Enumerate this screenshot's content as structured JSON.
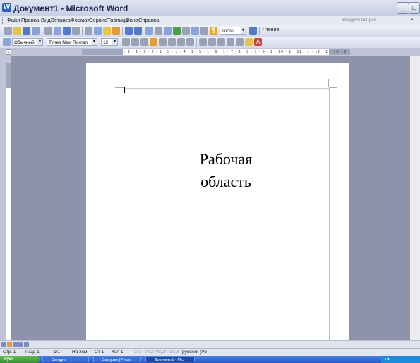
{
  "window": {
    "title": "Документ1 - Microsoft Word",
    "app_icon": "W"
  },
  "menubar": {
    "items": [
      "Файл",
      "Правка",
      "Вид",
      "Вставка",
      "Формат",
      "Сервис",
      "Таблица",
      "Окно",
      "Справка"
    ],
    "help_placeholder": "Введите вопрос"
  },
  "toolbar_standard": {
    "zoom": "100%",
    "reading_label": "Чтение"
  },
  "toolbar_formatting": {
    "style": "Обычный",
    "font": "Times New Roman",
    "size": "12",
    "letter": "A"
  },
  "ruler": {
    "ticks": "· 1 · 1 · 1 · 2 · 1 · 3 · 1 · 4 · 1 · 5 · 1 · 6 · 1 · 7 · 1 · 8 · 1 · 9 · 1 · 10 · 1 · 11 · 1 · 12 · 1 · 13 · 1 · 14 · 1 · 15 · 1 · 16 · 1 · 17 ·"
  },
  "document": {
    "label_line1": "Рабочая",
    "label_line2": "область"
  },
  "statusbar": {
    "page": "Стр. 1",
    "section": "Разд 1",
    "pages": "1/1",
    "position": "На 2см",
    "line": "Ст 1",
    "column": "Кол 1",
    "rec": "ЗАП",
    "trk": "ИСПР",
    "ext": "ВДЛ",
    "ovr": "ЗАМ",
    "language": "русский (Ро"
  },
  "taskbar": {
    "start": "пуск",
    "items": [
      "Сегодня",
      "Загрузки (Русск",
      "Документ1 - Micr"
    ]
  },
  "colors": {
    "workspace": "#8f93a9",
    "taskbar": "#2459c8",
    "start": "#3c8f35"
  }
}
